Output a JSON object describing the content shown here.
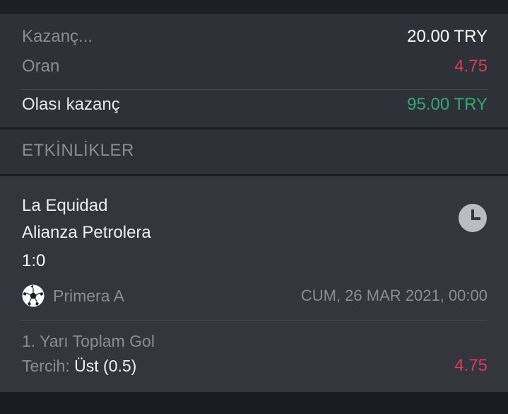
{
  "summary": {
    "stake_label": "Kazanç...",
    "stake_value": "20.00 TRY",
    "odds_label": "Oran",
    "odds_value": "4.75",
    "potential_label": "Olası kazanç",
    "potential_value": "95.00 TRY"
  },
  "events_section": {
    "title": "ETKİNLİKLER"
  },
  "event": {
    "home_team": "La Equidad",
    "away_team": "Alianza Petrolera",
    "score": "1:0",
    "league_icon": "soccer-ball-icon",
    "league": "Primera A",
    "datetime": "CUM, 26 MAR 2021, 00:00",
    "status_icon": "clock-icon",
    "market": "1. Yarı Toplam Gol",
    "pick_label": "Tercih:",
    "pick_value": "Üst (0.5)",
    "pick_odds": "4.75"
  },
  "colors": {
    "background": "#1c1f26",
    "panel": "#2e3138",
    "card": "#33363d",
    "accent_red": "#e0385a",
    "accent_green": "#2faa6e"
  }
}
